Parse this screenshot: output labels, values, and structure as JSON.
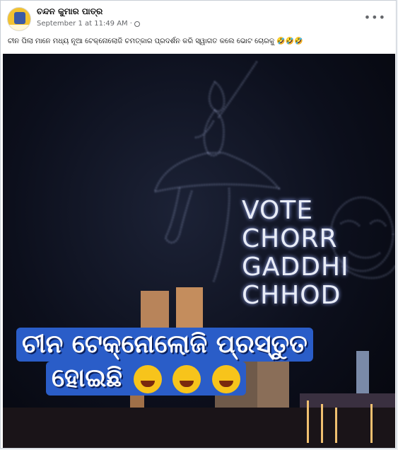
{
  "post": {
    "author": "ଚନ୍ଦନ କୁମାର ପାତ୍ର",
    "timestamp": "September 1 at 11:49 AM",
    "separator": "·",
    "privacy_icon": "globe-icon",
    "more_icon": "more-options-icon",
    "more_label": "•••",
    "caption": "ଚୀନ ପିଲା ମାନେ ମଧ୍ୟ ନୂଆ ଟେକ୍ନୋଲୋଜି ଚମତ୍କାର ପ୍ରଦର୍ଶନ କରି ସ୍ୱାଗତ କଲେ ଭୋଟ ଚୋରକୁ 🤣🤣🤣"
  },
  "image": {
    "drone_text": [
      "VOTE",
      "CHORR",
      "GADDHI",
      "CHHOD"
    ],
    "overlay_line1": "ଚୀନ ଟେକ୍ନୋଲୋଜି ପ୍ରସ୍ତୁତ",
    "overlay_line2": "ହୋଇଛି",
    "overlay_emojis": [
      "🤣",
      "🤣",
      "🤣"
    ]
  },
  "colors": {
    "overlay_bg": "#2a5dc8",
    "night_sky": "#0b0d1a",
    "drone_light": "#e8ecf7"
  }
}
